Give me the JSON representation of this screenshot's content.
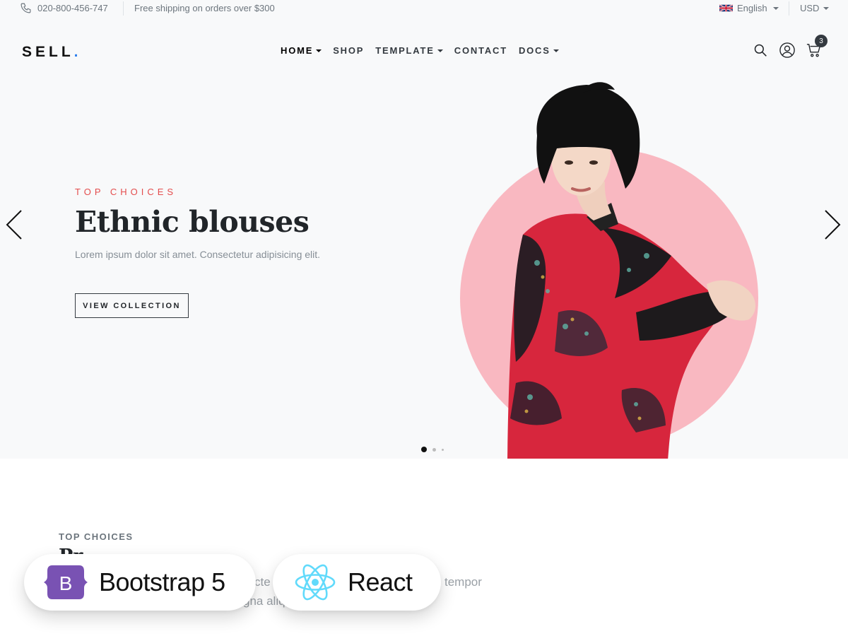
{
  "topbar": {
    "phone": "020-800-456-747",
    "shipping": "Free shipping on orders over $300",
    "language": "English",
    "currency": "USD"
  },
  "navbar": {
    "logo_text": "SELL",
    "logo_dot": ".",
    "items": [
      {
        "label": "HOME",
        "has_dropdown": true,
        "active": true
      },
      {
        "label": "SHOP",
        "has_dropdown": false
      },
      {
        "label": "TEMPLATE",
        "has_dropdown": true
      },
      {
        "label": "CONTACT",
        "has_dropdown": false
      },
      {
        "label": "DOCS",
        "has_dropdown": true
      }
    ],
    "cart_count": "3",
    "icons": [
      "search-icon",
      "user-icon",
      "cart-icon"
    ]
  },
  "hero": {
    "eyebrow": "TOP CHOICES",
    "title": "Ethnic blouses",
    "subtitle": "Lorem ipsum dolor sit amet. Consectetur adipisicing elit.",
    "button": "VIEW COLLECTION",
    "accent_color": "#e44d4d",
    "circle_color": "#f9b8c1",
    "slides": 3,
    "active_slide": 1
  },
  "section": {
    "eyebrow": "TOP CHOICES",
    "title_partial": "Pr",
    "text_line1_partial": "cte",
    "text_line1_tail": "smod tempor",
    "text_line2_partial": "gna aliq"
  },
  "badges": {
    "bootstrap": {
      "label": "Bootstrap 5",
      "color": "#7952b3"
    },
    "react": {
      "label": "React",
      "color": "#61dafb"
    }
  }
}
